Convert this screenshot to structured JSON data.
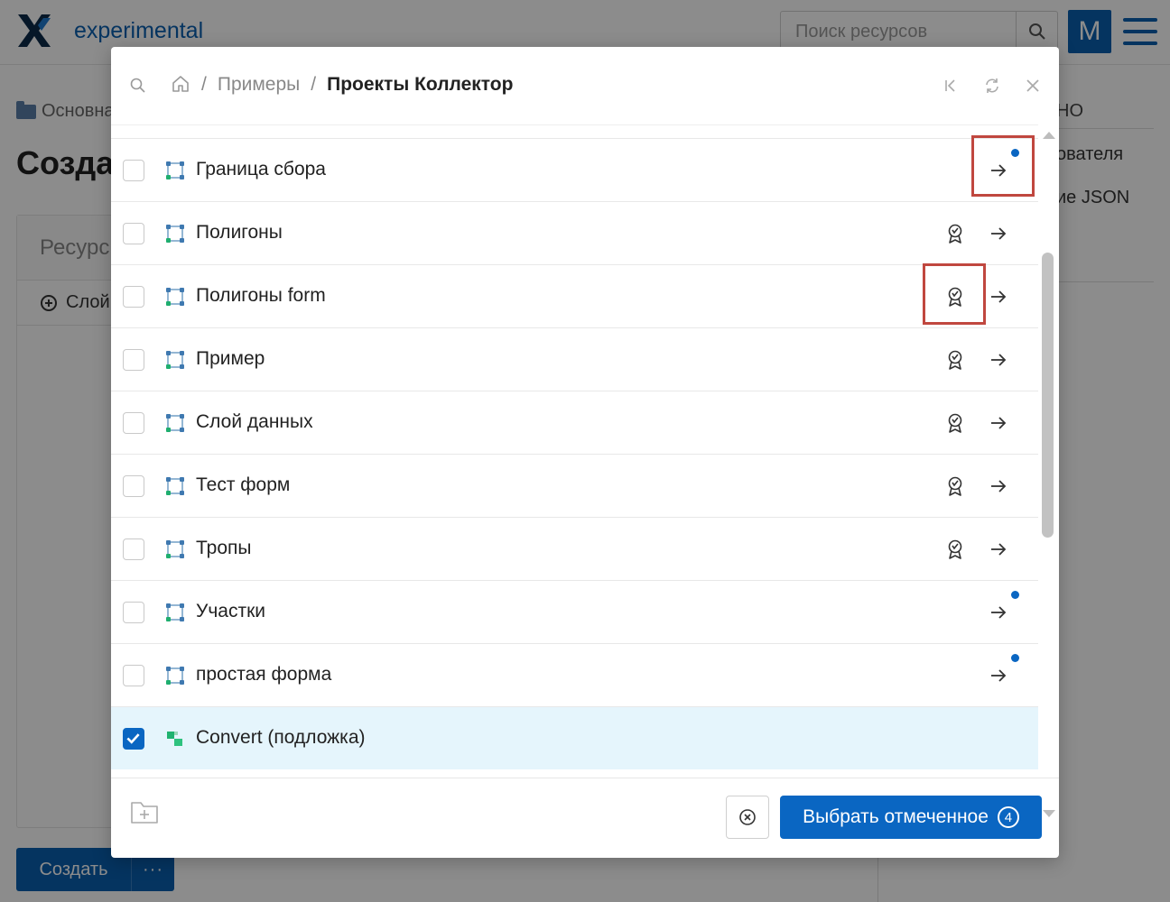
{
  "app": {
    "brand": "experimental",
    "search_placeholder": "Поиск ресурсов",
    "avatar_letter": "M"
  },
  "background": {
    "breadcrumb": "Основна",
    "title": "Созда",
    "panel_header": "Ресурс",
    "panel_row": "Слой",
    "side_title": "НО",
    "side_item_1": "ователя",
    "side_item_2": "ие JSON",
    "create_label": "Создать",
    "create_more": "···"
  },
  "modal": {
    "breadcrumbs": [
      {
        "label": "Примеры"
      },
      {
        "label": "Проекты Коллектор"
      }
    ],
    "separator": "/",
    "rows": [
      {
        "label": "Граница сбора",
        "checked": false,
        "badge": false,
        "dot": true,
        "icon": "vector-layer-icon"
      },
      {
        "label": "Полигоны",
        "checked": false,
        "badge": true,
        "dot": false,
        "icon": "vector-layer-icon"
      },
      {
        "label": "Полигоны form",
        "checked": false,
        "badge": true,
        "dot": false,
        "icon": "vector-layer-icon"
      },
      {
        "label": "Пример",
        "checked": false,
        "badge": true,
        "dot": false,
        "icon": "vector-layer-icon"
      },
      {
        "label": "Слой данных",
        "checked": false,
        "badge": true,
        "dot": false,
        "icon": "vector-layer-icon"
      },
      {
        "label": "Тест форм",
        "checked": false,
        "badge": true,
        "dot": false,
        "icon": "vector-layer-icon"
      },
      {
        "label": "Тропы",
        "checked": false,
        "badge": true,
        "dot": false,
        "icon": "vector-layer-icon"
      },
      {
        "label": "Участки",
        "checked": false,
        "badge": false,
        "dot": true,
        "icon": "vector-layer-icon"
      },
      {
        "label": "простая форма",
        "checked": false,
        "badge": false,
        "dot": true,
        "icon": "vector-layer-icon"
      },
      {
        "label": "Convert (подложка)",
        "checked": true,
        "badge": false,
        "dot": false,
        "icon": "basemap-icon"
      }
    ],
    "select_button_label": "Выбрать отмеченное",
    "selected_count": "4"
  },
  "colors": {
    "accent": "#0a66c2",
    "highlight_box": "#c0473f",
    "selected_row": "#e5f5fc"
  }
}
